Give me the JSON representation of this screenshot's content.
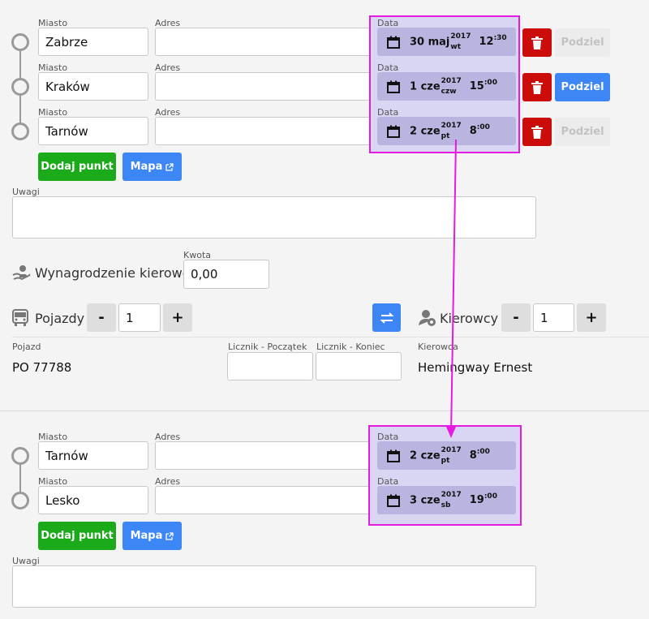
{
  "section1": {
    "points": [
      {
        "city_label": "Miasto",
        "city": "Zabrze",
        "address_label": "Adres",
        "address": "",
        "date_label": "Data",
        "day": "30 maj",
        "year": "2017",
        "weekday": "wt",
        "hour": "12",
        "minutes": ":30",
        "delete_enabled": true,
        "split_label": "Podziel",
        "split_enabled": false
      },
      {
        "city_label": "Miasto",
        "city": "Kraków",
        "address_label": "Adres",
        "address": "",
        "date_label": "Data",
        "day": "1 cze",
        "year": "2017",
        "weekday": "czw",
        "hour": "15",
        "minutes": ":00",
        "delete_enabled": true,
        "split_label": "Podziel",
        "split_enabled": true
      },
      {
        "city_label": "Miasto",
        "city": "Tarnów",
        "address_label": "Adres",
        "address": "",
        "date_label": "Data",
        "day": "2 cze",
        "year": "2017",
        "weekday": "pt",
        "hour": "8",
        "minutes": ":00",
        "delete_enabled": true,
        "split_label": "Podziel",
        "split_enabled": false
      }
    ],
    "add_point_label": "Dodaj punkt",
    "map_label": "Mapa",
    "notes_label": "Uwagi",
    "notes_value": ""
  },
  "remuneration": {
    "title": "Wynagrodzenie kierowcy",
    "amount_label": "Kwota",
    "amount_value": "0,00"
  },
  "vehicles": {
    "title": "Pojazdy",
    "minus": "-",
    "count": "1",
    "plus": "+",
    "vehicle_label": "Pojazd",
    "vehicle_value": "PO 77788",
    "odometer_start_label": "Licznik - Początek",
    "odometer_end_label": "Licznik - Koniec"
  },
  "drivers": {
    "title": "Kierowcy",
    "minus": "-",
    "count": "1",
    "plus": "+",
    "driver_label": "Kierowca",
    "driver_value": "Hemingway Ernest"
  },
  "section2": {
    "points": [
      {
        "city_label": "Miasto",
        "city": "Tarnów",
        "address_label": "Adres",
        "address": "",
        "date_label": "Data",
        "day": "2 cze",
        "year": "2017",
        "weekday": "pt",
        "hour": "8",
        "minutes": ":00"
      },
      {
        "city_label": "Miasto",
        "city": "Lesko",
        "address_label": "Adres",
        "address": "",
        "date_label": "Data",
        "day": "3 cze",
        "year": "2017",
        "weekday": "sb",
        "hour": "19",
        "minutes": ":00"
      }
    ],
    "add_point_label": "Dodaj punkt",
    "map_label": "Mapa",
    "notes_label": "Uwagi",
    "notes_value": ""
  },
  "colors": {
    "highlight": "#e51be0",
    "date_bg": "#b9b5e0",
    "primary": "#3d86f5",
    "success": "#1aaa1a",
    "danger": "#cc0b0b"
  },
  "icons": {
    "calendar": "calendar-icon",
    "trash": "trash-icon",
    "external": "external-link-icon",
    "hand_money": "hand-money-icon",
    "bus": "bus-icon",
    "swap": "swap-icon",
    "driver": "driver-icon"
  }
}
